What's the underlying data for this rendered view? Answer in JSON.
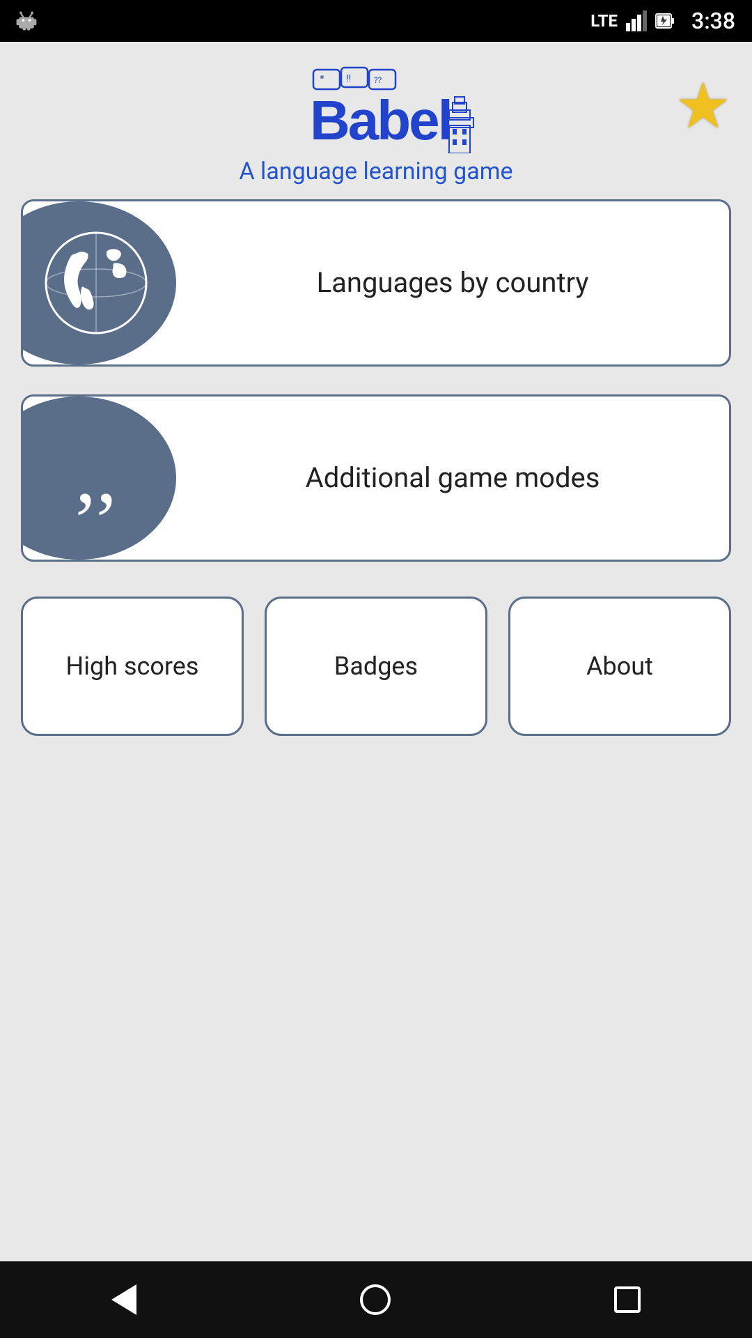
{
  "statusBar": {
    "time": "3:38",
    "lte": "LTE",
    "signal": "▲",
    "battery": "⚡"
  },
  "header": {
    "logoAlt": "Babel - A language learning game",
    "subtitle": "A language learning game",
    "starAlt": "favorites-star"
  },
  "buttons": {
    "languagesByCountry": "Languages by\ncountry",
    "additionalGameModes": "Additional game modes",
    "highScores": "High scores",
    "badges": "Badges",
    "about": "About"
  },
  "nav": {
    "back": "back",
    "home": "home",
    "recent": "recent"
  }
}
